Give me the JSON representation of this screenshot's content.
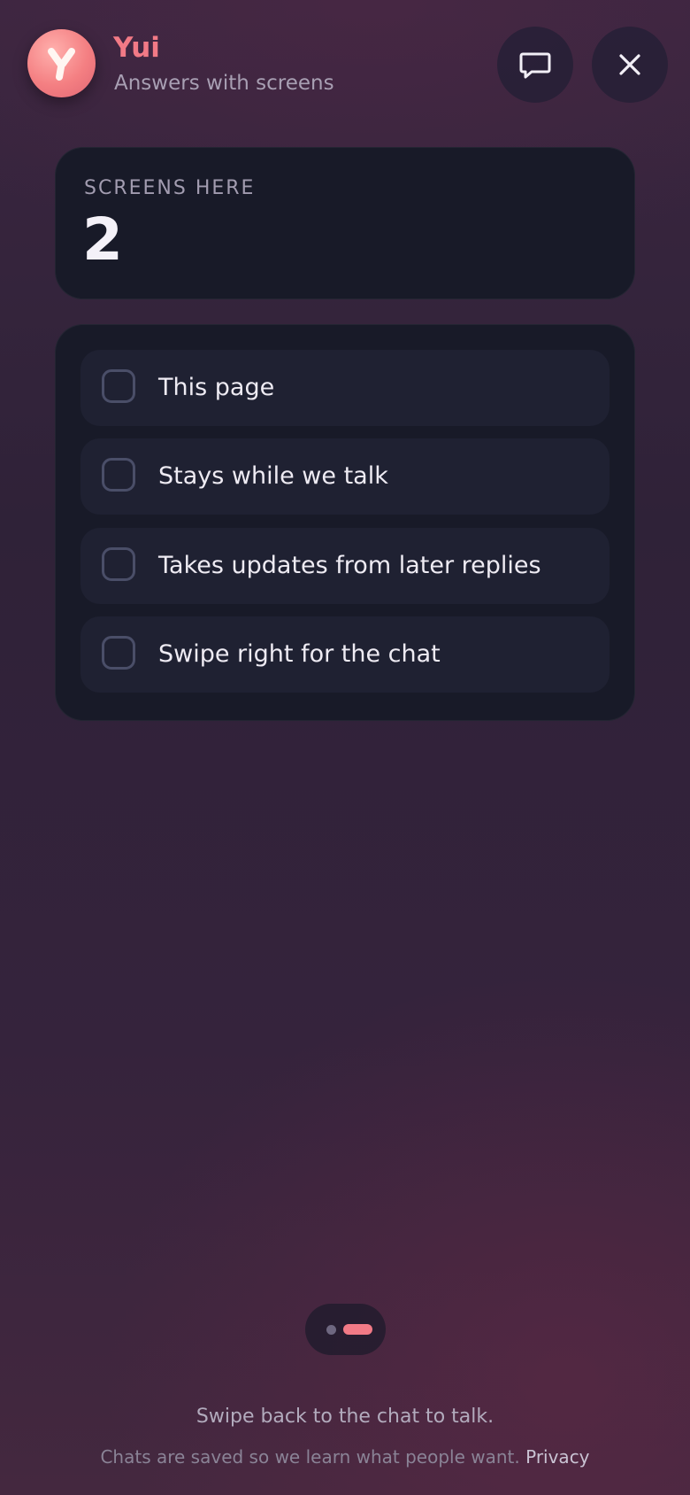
{
  "header": {
    "name": "Yui",
    "subtitle": "Answers with screens",
    "avatar_icon": "yui-logo-icon",
    "chat_icon": "chat-bubble-icon",
    "close_icon": "close-icon"
  },
  "summary": {
    "label": "SCREENS HERE",
    "count": "2"
  },
  "checklist": {
    "items": [
      {
        "label": "This page",
        "checked": false
      },
      {
        "label": "Stays while we talk",
        "checked": false
      },
      {
        "label": "Takes updates from later replies",
        "checked": false
      },
      {
        "label": "Swipe right for the chat",
        "checked": false
      }
    ]
  },
  "pager": {
    "pages": 2,
    "active_page": 2
  },
  "footer": {
    "hint": "Swipe back to the chat to talk.",
    "legal_text": "Chats are saved so we learn what people want.",
    "privacy_link": "Privacy"
  },
  "colors": {
    "accent": "#f27a86",
    "card_background": "#181a28",
    "item_background": "#1f2132"
  }
}
